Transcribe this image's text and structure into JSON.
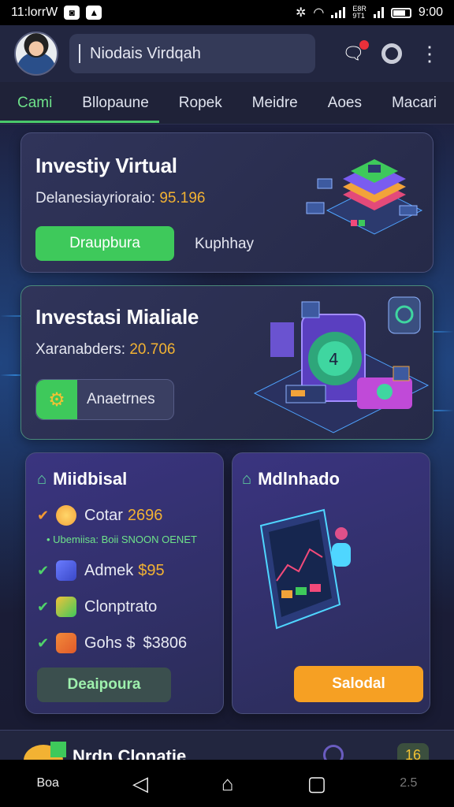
{
  "status_bar": {
    "time_left": "11:lorrW",
    "app_icon_1": "photo-app-icon",
    "app_icon_2": "gallery-app-icon",
    "time_right": "9:00",
    "net_label": "E8R\n9T1"
  },
  "header": {
    "search_text": "Niodais Virdqah",
    "icons": [
      "avatar",
      "notification-icon",
      "settings-icon",
      "more-icon"
    ]
  },
  "tabs": [
    {
      "label": "Cami",
      "active": true
    },
    {
      "label": "Bllopaune",
      "active": false
    },
    {
      "label": "Ropek",
      "active": false
    },
    {
      "label": "Meidre",
      "active": false
    },
    {
      "label": "Aoes",
      "active": false
    },
    {
      "label": "Macari",
      "active": false
    }
  ],
  "card1": {
    "title": "Investiy Virtual",
    "meta_label": "Delanesiayrioraio:",
    "meta_value": "95.196",
    "primary_button": "Draupbura",
    "secondary_link": "Kuphhay"
  },
  "card2": {
    "title": "Investasi Mialiale",
    "meta_label": "Xaranabders:",
    "meta_value": "20.706",
    "button": "Anaetrnes"
  },
  "card3": {
    "title": "Miidbisal",
    "items": [
      {
        "label": "Cotar",
        "value": "2696",
        "icon": "coin-icon"
      },
      {
        "label": "Admek",
        "value": "$95",
        "icon": "cube-icon"
      },
      {
        "label": "Clonptrato",
        "value": "",
        "icon": "box-icon"
      },
      {
        "label": "Gohs $",
        "value": "$3806",
        "icon": "package-icon"
      }
    ],
    "note": "• Ubemiisa: Boii SNOON OENET",
    "button": "Deaipoura"
  },
  "card4": {
    "title": "Mdlnhado",
    "button": "Salodal"
  },
  "peek": {
    "title": "Nrdn Clonatie",
    "badge": "16"
  },
  "navbar": {
    "left_label": "Boa",
    "right_label": "2.5"
  },
  "colors": {
    "accent_green": "#3ec95b",
    "accent_orange": "#f6a023",
    "value_gold": "#f2b233",
    "background": "#1b1e3a"
  }
}
